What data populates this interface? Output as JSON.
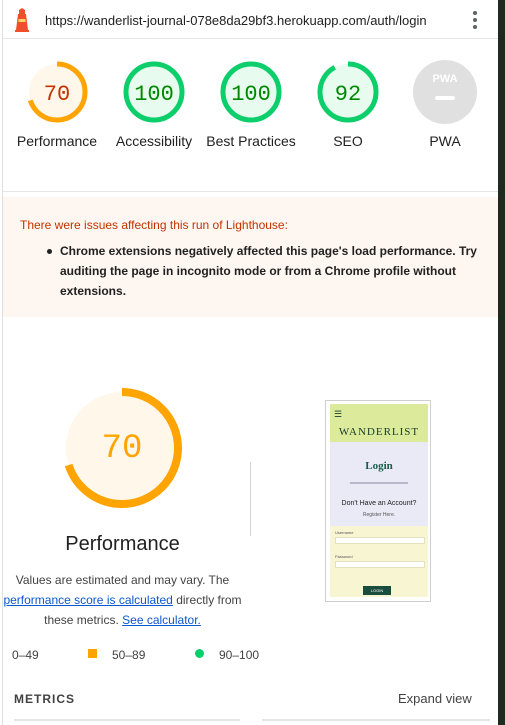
{
  "topbar": {
    "url": "https://wanderlist-journal-078e8da29bf3.herokuapp.com/auth/login"
  },
  "gauges": [
    {
      "score": "70",
      "label": "Performance",
      "value": 0.7,
      "status": "average"
    },
    {
      "score": "100",
      "label": "Accessibility",
      "value": 1.0,
      "status": "pass"
    },
    {
      "score": "100",
      "label": "Best Practices",
      "value": 1.0,
      "status": "pass"
    },
    {
      "score": "92",
      "label": "SEO",
      "value": 0.92,
      "status": "pass"
    },
    {
      "score": "PWA",
      "label": "PWA",
      "value": 0,
      "status": "na"
    }
  ],
  "warning": {
    "title": "There were issues affecting this run of Lighthouse:",
    "item": "Chrome extensions negatively affected this page's load performance. Try auditing the page in incognito mode or from a Chrome profile without extensions."
  },
  "performance": {
    "score": "70",
    "value": 0.7,
    "title": "Performance",
    "desc_1": "Values are estimated and may vary. The",
    "desc_link": "performance score is calculated",
    "desc_2": "directly from",
    "desc_3": "these metrics.",
    "desc_link2": "See calculator."
  },
  "legend": {
    "fail": "0–49",
    "average": "50–89",
    "pass": "90–100"
  },
  "metrics": {
    "title": "METRICS",
    "expand": "Expand view"
  },
  "thumbnail": {
    "brand": "WANDERLIST",
    "heading": "Login",
    "question": "Don't Have an Account?",
    "register": "Register Here.",
    "username_label": "Username",
    "password_label": "Password",
    "button": "LOGIN"
  },
  "colors": {
    "fail": "#ff4e42",
    "average": "#ffa400",
    "pass": "#0cce6b",
    "average_text": "#c33300",
    "pass_text": "#008800",
    "na": "#9e9e9e"
  }
}
